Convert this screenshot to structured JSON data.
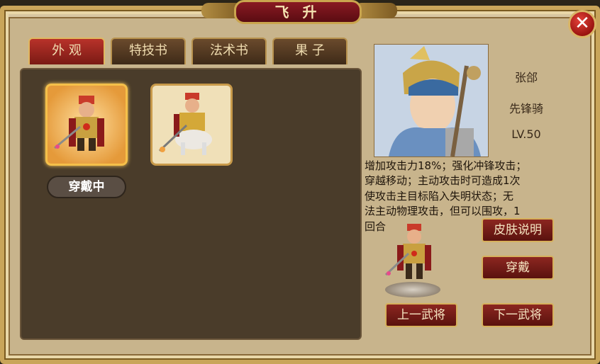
{
  "window": {
    "title": "飞 升"
  },
  "close": {
    "symbol": "✕"
  },
  "tabs": [
    {
      "label": "外  观",
      "active": true
    },
    {
      "label": "特技书",
      "active": false
    },
    {
      "label": "法术书",
      "active": false
    },
    {
      "label": "果  子",
      "active": false
    }
  ],
  "skins": [
    {
      "name": "skin-1",
      "selected": true
    },
    {
      "name": "skin-2",
      "selected": false
    }
  ],
  "equipped_label": "穿戴中",
  "general": {
    "name": "张郃",
    "class": "先锋骑",
    "level": "LV.50"
  },
  "description_lines": [
    "增加攻击力18%；强化冲锋攻击；",
    "穿越移动；主动攻击时可造成1次",
    "使攻击主目标陷入失明状态；无",
    "法主动物理攻击，但可以围攻，1",
    "回合"
  ],
  "buttons": {
    "skin_info": "皮肤说明",
    "wear": "穿戴",
    "prev_general": "上一武将",
    "next_general": "下一武将"
  },
  "colors": {
    "frame_gold": "#c9a55a",
    "button_red": "#8c2620",
    "tab_active": "#b8322a"
  }
}
